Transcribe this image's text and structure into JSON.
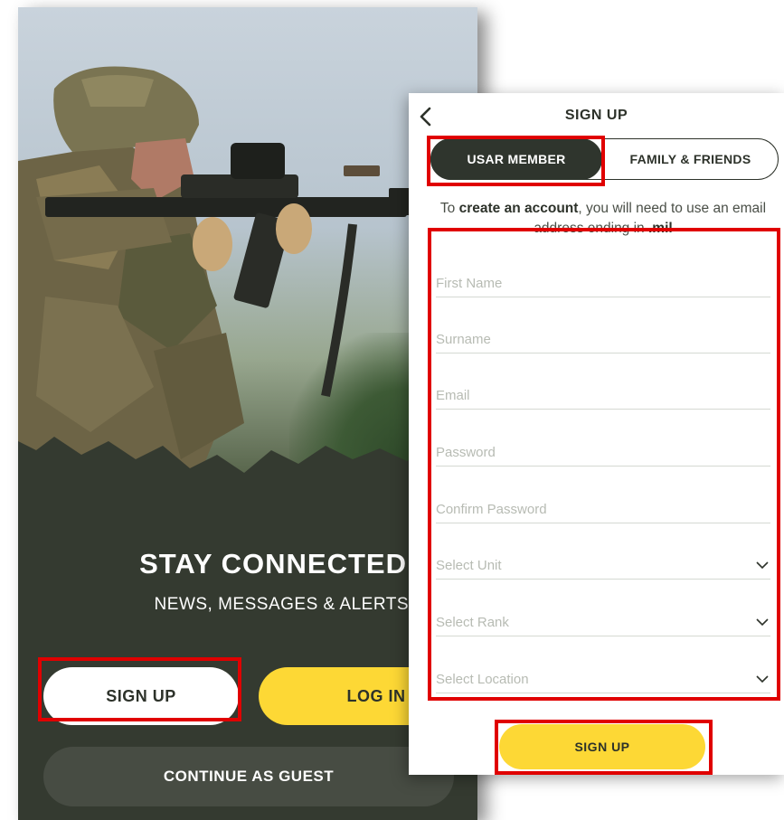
{
  "landing": {
    "title": "STAY CONNECTED",
    "subtitle": "NEWS, MESSAGES & ALERTS",
    "signup_label": "SIGN UP",
    "login_label": "LOG IN",
    "guest_label": "CONTINUE AS GUEST"
  },
  "signup": {
    "header_title": "SIGN UP",
    "tabs": [
      "USAR MEMBER",
      "FAMILY & FRIENDS"
    ],
    "selected_tab": "USAR MEMBER",
    "info_prefix": "To ",
    "info_bold": "create an account",
    "info_middle": ", you will need to use an email address ending in ",
    "info_domain": ".mil",
    "fields": {
      "first_name": "First Name",
      "surname": "Surname",
      "email": "Email",
      "password": "Password",
      "confirm_password": "Confirm Password"
    },
    "selects": {
      "unit": "Select Unit",
      "rank": "Select Rank",
      "location": "Select Location"
    },
    "submit_label": "SIGN UP"
  },
  "colors": {
    "accent_yellow": "#fdd835",
    "dark_olive": "#2f352d",
    "highlight_red": "#e00000"
  }
}
